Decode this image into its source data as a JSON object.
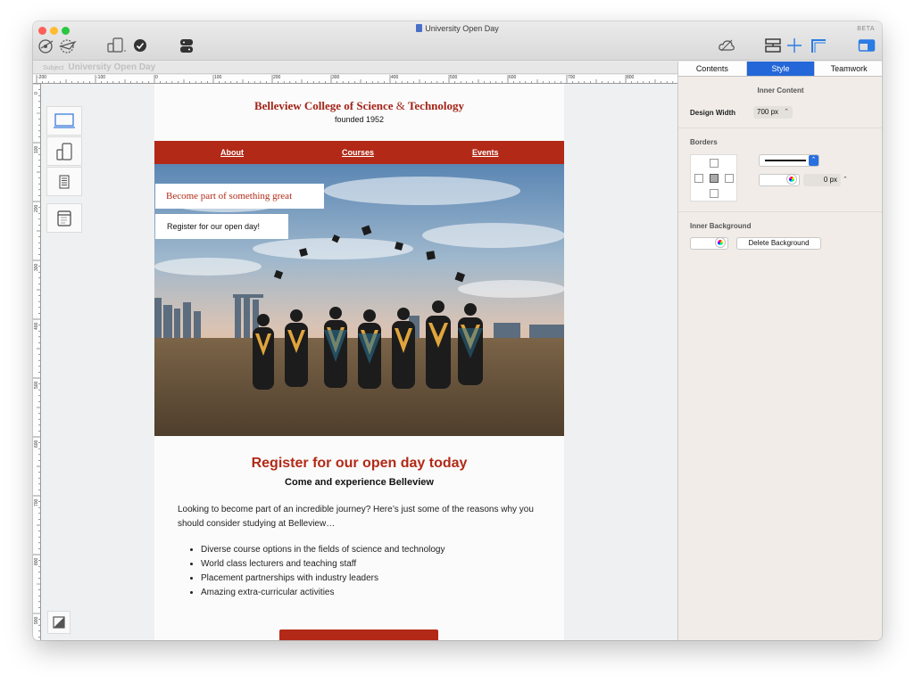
{
  "window": {
    "title": "University Open Day",
    "badge": "BETA"
  },
  "toolbar": {
    "left_icons": [
      "preview-icon",
      "send-test-icon",
      "devices-icon",
      "checkmark-icon",
      "spam-check-icon"
    ],
    "right_icons": [
      "cloud-icon",
      "layout-blocks-icon",
      "move-icon",
      "ruler-guides-icon",
      "sidebar-toggle-icon"
    ]
  },
  "subject": {
    "label": "Subject",
    "value": "University Open Day"
  },
  "ruler": {
    "h_labels": [
      "-200",
      "-100",
      "0",
      "100",
      "200",
      "300",
      "400",
      "500",
      "600",
      "700",
      "800"
    ],
    "v_labels": [
      "0",
      "100",
      "200",
      "300",
      "400",
      "500",
      "600",
      "700",
      "800",
      "900"
    ]
  },
  "device_buttons": [
    "desktop-view-icon",
    "mobile-tablet-view-icon",
    "plain-text-view-icon",
    "source-view-icon",
    "layers-icon"
  ],
  "email": {
    "college_name_1": "Belleview College of Science",
    "college_amp": "&",
    "college_name_2": "Technology",
    "founded": "founded 1952",
    "nav": [
      "About",
      "Courses",
      "Events"
    ],
    "hero_tag_1": "Become part of something great",
    "hero_tag_2": "Register for our open day!",
    "heading": "Register for our open day today",
    "subheading": "Come and experience Belleview",
    "paragraph": "Looking to become part of an incredible journey? Here’s just some of the reasons why you should consider studying at Belleview…",
    "bullets": [
      "Diverse course options in the fields of science and technology",
      "World class lecturers and teaching staff",
      "Placement partnerships with industry leaders",
      "Amazing extra-curricular activities"
    ]
  },
  "sidebar": {
    "tabs": [
      "Contents",
      "Style",
      "Teamwork"
    ],
    "active_tab": "Style",
    "inner_content_title": "Inner Content",
    "design_width_label": "Design Width",
    "design_width_value": "700 px",
    "borders_title": "Borders",
    "border_width_value": "0 px",
    "inner_background_title": "Inner Background",
    "delete_background_label": "Delete Background"
  },
  "colors": {
    "brand_red": "#b22a17",
    "accent_blue": "#2467d8"
  }
}
